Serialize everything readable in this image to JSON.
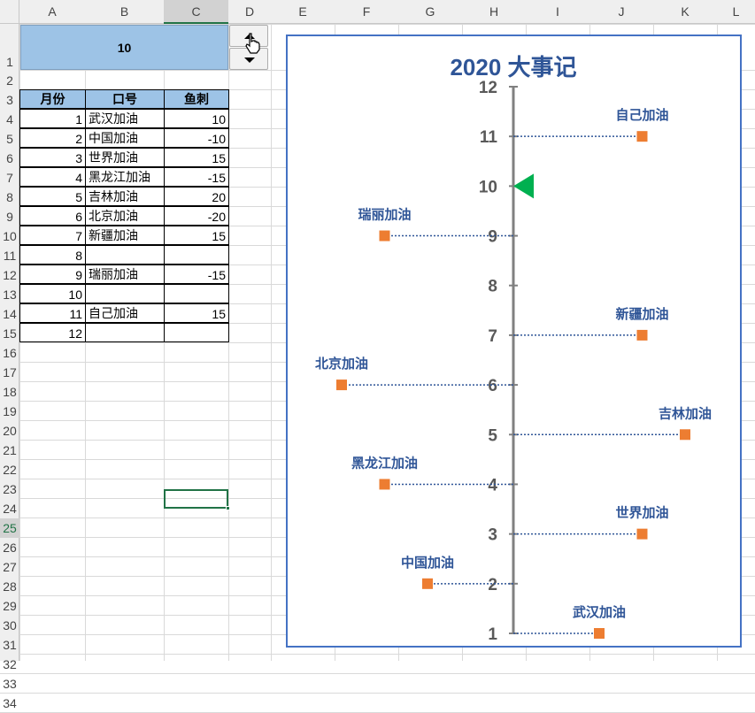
{
  "sheet": {
    "columns": [
      "A",
      "B",
      "C",
      "D",
      "E",
      "F",
      "G",
      "H",
      "I",
      "J",
      "K",
      "L"
    ],
    "rows": [
      "1",
      "2",
      "3",
      "4",
      "5",
      "6",
      "7",
      "8",
      "9",
      "10",
      "11",
      "12",
      "13",
      "14",
      "15",
      "16",
      "17",
      "18",
      "19",
      "20",
      "21",
      "22",
      "23",
      "24",
      "25",
      "26",
      "27",
      "28",
      "29",
      "30",
      "31",
      "32",
      "33",
      "34"
    ],
    "selected_cell": "C25",
    "banner_value": "10",
    "table_headers": [
      "月份",
      "口号",
      "鱼刺"
    ],
    "table_rows": [
      {
        "month": "1",
        "slogan": "武汉加油",
        "offset": "10"
      },
      {
        "month": "2",
        "slogan": "中国加油",
        "offset": "-10"
      },
      {
        "month": "3",
        "slogan": "世界加油",
        "offset": "15"
      },
      {
        "month": "4",
        "slogan": "黑龙江加油",
        "offset": "-15"
      },
      {
        "month": "5",
        "slogan": "吉林加油",
        "offset": "20"
      },
      {
        "month": "6",
        "slogan": "北京加油",
        "offset": "-20"
      },
      {
        "month": "7",
        "slogan": "新疆加油",
        "offset": "15"
      },
      {
        "month": "8",
        "slogan": "",
        "offset": ""
      },
      {
        "month": "9",
        "slogan": "瑞丽加油",
        "offset": "-15"
      },
      {
        "month": "10",
        "slogan": "",
        "offset": ""
      },
      {
        "month": "11",
        "slogan": "自己加油",
        "offset": "15"
      },
      {
        "month": "12",
        "slogan": "",
        "offset": ""
      }
    ]
  },
  "spinner": {
    "up_icon": "up-arrow",
    "down_icon": "down-arrow"
  },
  "chart_data": {
    "type": "scatter",
    "title": "2020 大事记",
    "ylim": [
      1,
      12
    ],
    "y_ticks": [
      "1",
      "2",
      "3",
      "4",
      "5",
      "6",
      "7",
      "8",
      "9",
      "10",
      "11",
      "12"
    ],
    "current_marker": 10,
    "marker_color": "#00b050",
    "point_color": "#ed7d31",
    "axis_color": "#808080",
    "label_color": "#2f5597",
    "points": [
      {
        "month": 1,
        "offset": 10,
        "label": "武汉加油"
      },
      {
        "month": 2,
        "offset": -10,
        "label": "中国加油"
      },
      {
        "month": 3,
        "offset": 15,
        "label": "世界加油"
      },
      {
        "month": 4,
        "offset": -15,
        "label": "黑龙江加油"
      },
      {
        "month": 5,
        "offset": 20,
        "label": "吉林加油"
      },
      {
        "month": 6,
        "offset": -20,
        "label": "北京加油"
      },
      {
        "month": 7,
        "offset": 15,
        "label": "新疆加油"
      },
      {
        "month": 9,
        "offset": -15,
        "label": "瑞丽加油"
      },
      {
        "month": 11,
        "offset": 15,
        "label": "自己加油"
      }
    ]
  }
}
